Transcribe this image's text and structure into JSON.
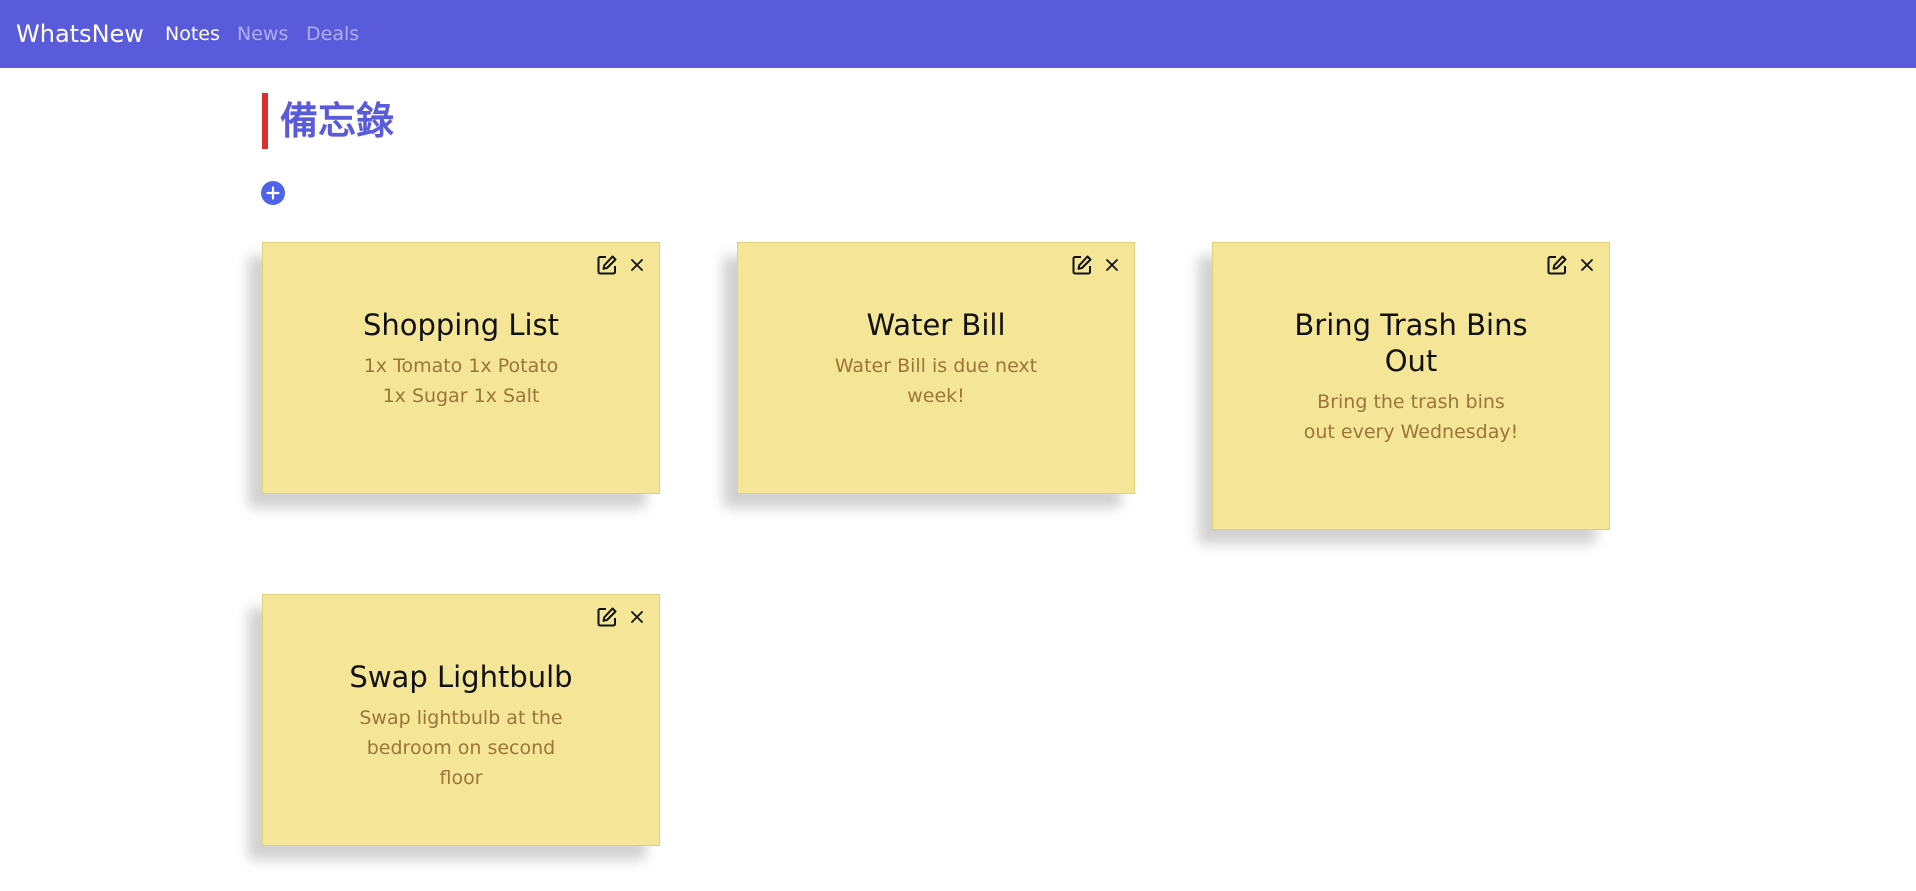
{
  "navbar": {
    "brand": "WhatsNew",
    "links": [
      {
        "label": "Notes",
        "active": true
      },
      {
        "label": "News",
        "active": false
      },
      {
        "label": "Deals",
        "active": false
      }
    ]
  },
  "page": {
    "title": "備忘錄"
  },
  "icons": {
    "add": "plus-circle-icon",
    "edit": "edit-icon",
    "close": "close-icon"
  },
  "colors": {
    "navbar": "#5a5bda",
    "title": "#5a5bda",
    "title_accent": "#dc2e2e",
    "add_button": "#4f63e8",
    "note_background": "#f4e597",
    "note_body_text": "#9b7636"
  },
  "notes": [
    {
      "title": "Shopping List",
      "body": "1x Tomato 1x Potato 1x Sugar 1x Salt"
    },
    {
      "title": "Water Bill",
      "body": "Water Bill is due next week!"
    },
    {
      "title": "Bring Trash Bins Out",
      "body": "Bring the trash bins out every Wednesday!"
    },
    {
      "title": "Swap Lightbulb",
      "body": "Swap lightbulb at the bedroom on second floor"
    }
  ]
}
